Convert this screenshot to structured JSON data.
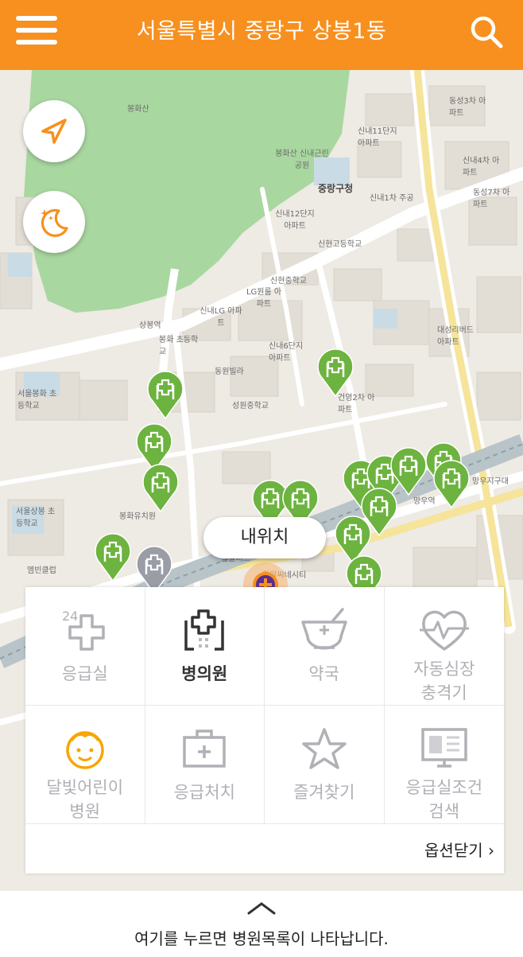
{
  "header": {
    "title": "서울특별시 중랑구 상봉1동",
    "menu_icon": "hamburger-menu-icon",
    "search_icon": "search-icon"
  },
  "colors": {
    "brand_orange": "#f7901e",
    "pin_green": "#6db33f",
    "park_green": "#a9d7a0",
    "my_location_purple": "#5b2d8e"
  },
  "map": {
    "labels": [
      "봉화산",
      "봉화산 신내근린공원",
      "중랑구청",
      "신내12단지 아파트",
      "신현고등학교",
      "신내1차 주공",
      "신내11단지 아파트",
      "동성3차 아파트",
      "신내4차 아파트",
      "동성7차 아파트",
      "신현중학교",
      "LG원룸 아파트",
      "신내LG 아파트",
      "봉화 초등학교",
      "상봉역",
      "동원빌라",
      "신내6단지 아파트",
      "대성리버드 아파트",
      "건영2차 아파트",
      "성원중학교",
      "봉화유치원",
      "서울봉화 초등학교",
      "홈플러스",
      "망우지구대",
      "망우역",
      "서울상봉 초등학교",
      "엠빈클럽",
      "한일씨네시티"
    ],
    "my_location_label": "내위치",
    "locate_icon": "navigation-arrow-icon",
    "night_mode_icon": "moon-stars-icon"
  },
  "panel": {
    "categories": [
      {
        "label": "응급실",
        "icon": "24h-cross-icon",
        "active": false
      },
      {
        "label": "병의원",
        "icon": "hospital-building-icon",
        "active": true
      },
      {
        "label": "약국",
        "icon": "pharmacy-bowl-icon",
        "active": false
      },
      {
        "label": "자동심장\n충격기",
        "icon": "heart-pulse-icon",
        "active": false
      },
      {
        "label": "달빛어린이\n병원",
        "icon": "child-face-icon",
        "active": false
      },
      {
        "label": "응급처치",
        "icon": "first-aid-kit-icon",
        "active": false
      },
      {
        "label": "즐겨찾기",
        "icon": "star-icon",
        "active": false
      },
      {
        "label": "응급실조건\n검색",
        "icon": "monitor-search-icon",
        "active": false
      }
    ],
    "close_options": "옵션닫기 ›"
  },
  "bottom_bar": {
    "chevron_icon": "chevron-up-icon",
    "text": "여기를 누르면 병원목록이 나타납니다."
  }
}
